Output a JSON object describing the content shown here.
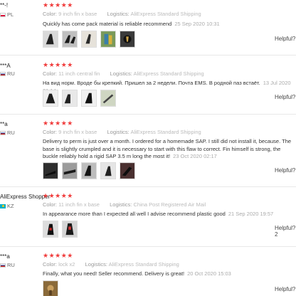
{
  "labels": {
    "color": "Color:",
    "logistics": "Logistics:",
    "helpful": "Helpful?"
  },
  "reviews": [
    {
      "name": "**-!",
      "country": "PL",
      "stars": "★★★★★",
      "color": "9 inch fin x base",
      "logistics": "AliExpress Standard Shipping",
      "text": "Quickly has come pack material is reliable recommend",
      "date": "25 Sep 2020 10:31"
    },
    {
      "name": "***A",
      "country": "RU",
      "stars": "★★★★★",
      "color": "11 inch central fin",
      "logistics": "AliExpress Standard Shipping",
      "text": "На вид норм. Вроде бы крепкий. Пришел за 2 недели. Почта EMS. В родной паз встаёт.",
      "date": "13 Jul 2020 21:14"
    },
    {
      "name": "**a",
      "country": "RU",
      "stars": "★★★★★",
      "color": "9 inch fin x base",
      "logistics": "AliExpress Standard Shipping",
      "text": "Delivery to perm is just over a month. I ordered for a homemade SAP. I still did not install it, because. The base is slightly crumpled and it is necessary to start with this flaw to correct. Fin himself is strong, the buckle reliably hold a rigid SAP 3.5 m long the most it!",
      "date": "23 Oct 2020 02:17"
    },
    {
      "name": "AliExpress Shopper",
      "country": "KZ",
      "stars": "★★★★★",
      "color": "11 inch fin x base",
      "logistics": "China Post Registered Air Mail",
      "text": "In appearance more than I expected all well I advise recommend plastic good",
      "date": "21 Sep 2020 19:57",
      "helpful_count": "2"
    },
    {
      "name": "***a",
      "country": "RU",
      "stars": "★★★★★",
      "color": "lock x2",
      "logistics": "AliExpress Standard Shipping",
      "text": "Finally, what you need! Seller recommend. Delivery is great!",
      "date": "20 Oct 2020 15:03"
    }
  ]
}
